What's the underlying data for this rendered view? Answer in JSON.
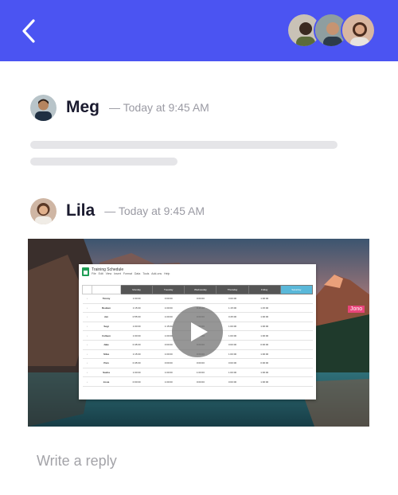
{
  "header": {
    "accent": "#4b54f2",
    "back_icon": "chevron-left-icon",
    "participants": [
      "participant-avatar-1",
      "participant-avatar-2",
      "participant-avatar-3"
    ]
  },
  "messages": [
    {
      "name": "Meg",
      "time": "— Today at 9:45 AM"
    },
    {
      "name": "Lila",
      "time": "— Today at 9:45 AM"
    }
  ],
  "video": {
    "play_icon": "play-icon",
    "sheet": {
      "title": "Training Schedule",
      "menu": "File Edit View Insert Format Data Tools Add-ons Help",
      "tag": "Jono",
      "columns": [
        "Monday",
        "Tuesday",
        "Wednesday",
        "Thursday",
        "Friday",
        "Saturday"
      ],
      "rows": [
        {
          "name": "Timmy",
          "cells": [
            "1:00:00",
            "0:00:00",
            "0:00:00",
            "0:00:00",
            "1:00:00"
          ]
        },
        {
          "name": "Reuben",
          "cells": [
            "1:15:00",
            "1:00:00",
            "0:45:00",
            "1:15:00",
            "1:15:00"
          ]
        },
        {
          "name": "Jen",
          "cells": [
            "0:55:00",
            "1:00:00",
            "0:00:00",
            "0:45:00",
            "1:00:00"
          ]
        },
        {
          "name": "Segi",
          "cells": [
            "1:00:00",
            "1:15:00",
            "0:00:00",
            "1:00:00",
            "1:00:00"
          ]
        },
        {
          "name": "Colleen",
          "cells": [
            "1:00:00",
            "1:00:00",
            "1:15:00",
            "1:00:00",
            "1:00:00"
          ]
        },
        {
          "name": "Jake",
          "cells": [
            "0:45:00",
            "0:00:00",
            "0:00:00",
            "0:00:00",
            "0:00:00"
          ]
        },
        {
          "name": "Silva",
          "cells": [
            "1:15:00",
            "1:00:00",
            "0:00:00",
            "1:00:00",
            "1:00:00"
          ]
        },
        {
          "name": "Pam",
          "cells": [
            "0:45:00",
            "0:00:00",
            "0:00:00",
            "0:00:00",
            "0:00:00"
          ]
        },
        {
          "name": "Sasha",
          "cells": [
            "1:00:00",
            "1:00:00",
            "1:00:00",
            "1:00:00",
            "1:00:00"
          ]
        },
        {
          "name": "Josie",
          "cells": [
            "0:00:00",
            "1:00:00",
            "0:00:00",
            "0:00:00",
            "1:00:00"
          ]
        }
      ]
    }
  },
  "reply": {
    "placeholder": "Write a reply"
  }
}
